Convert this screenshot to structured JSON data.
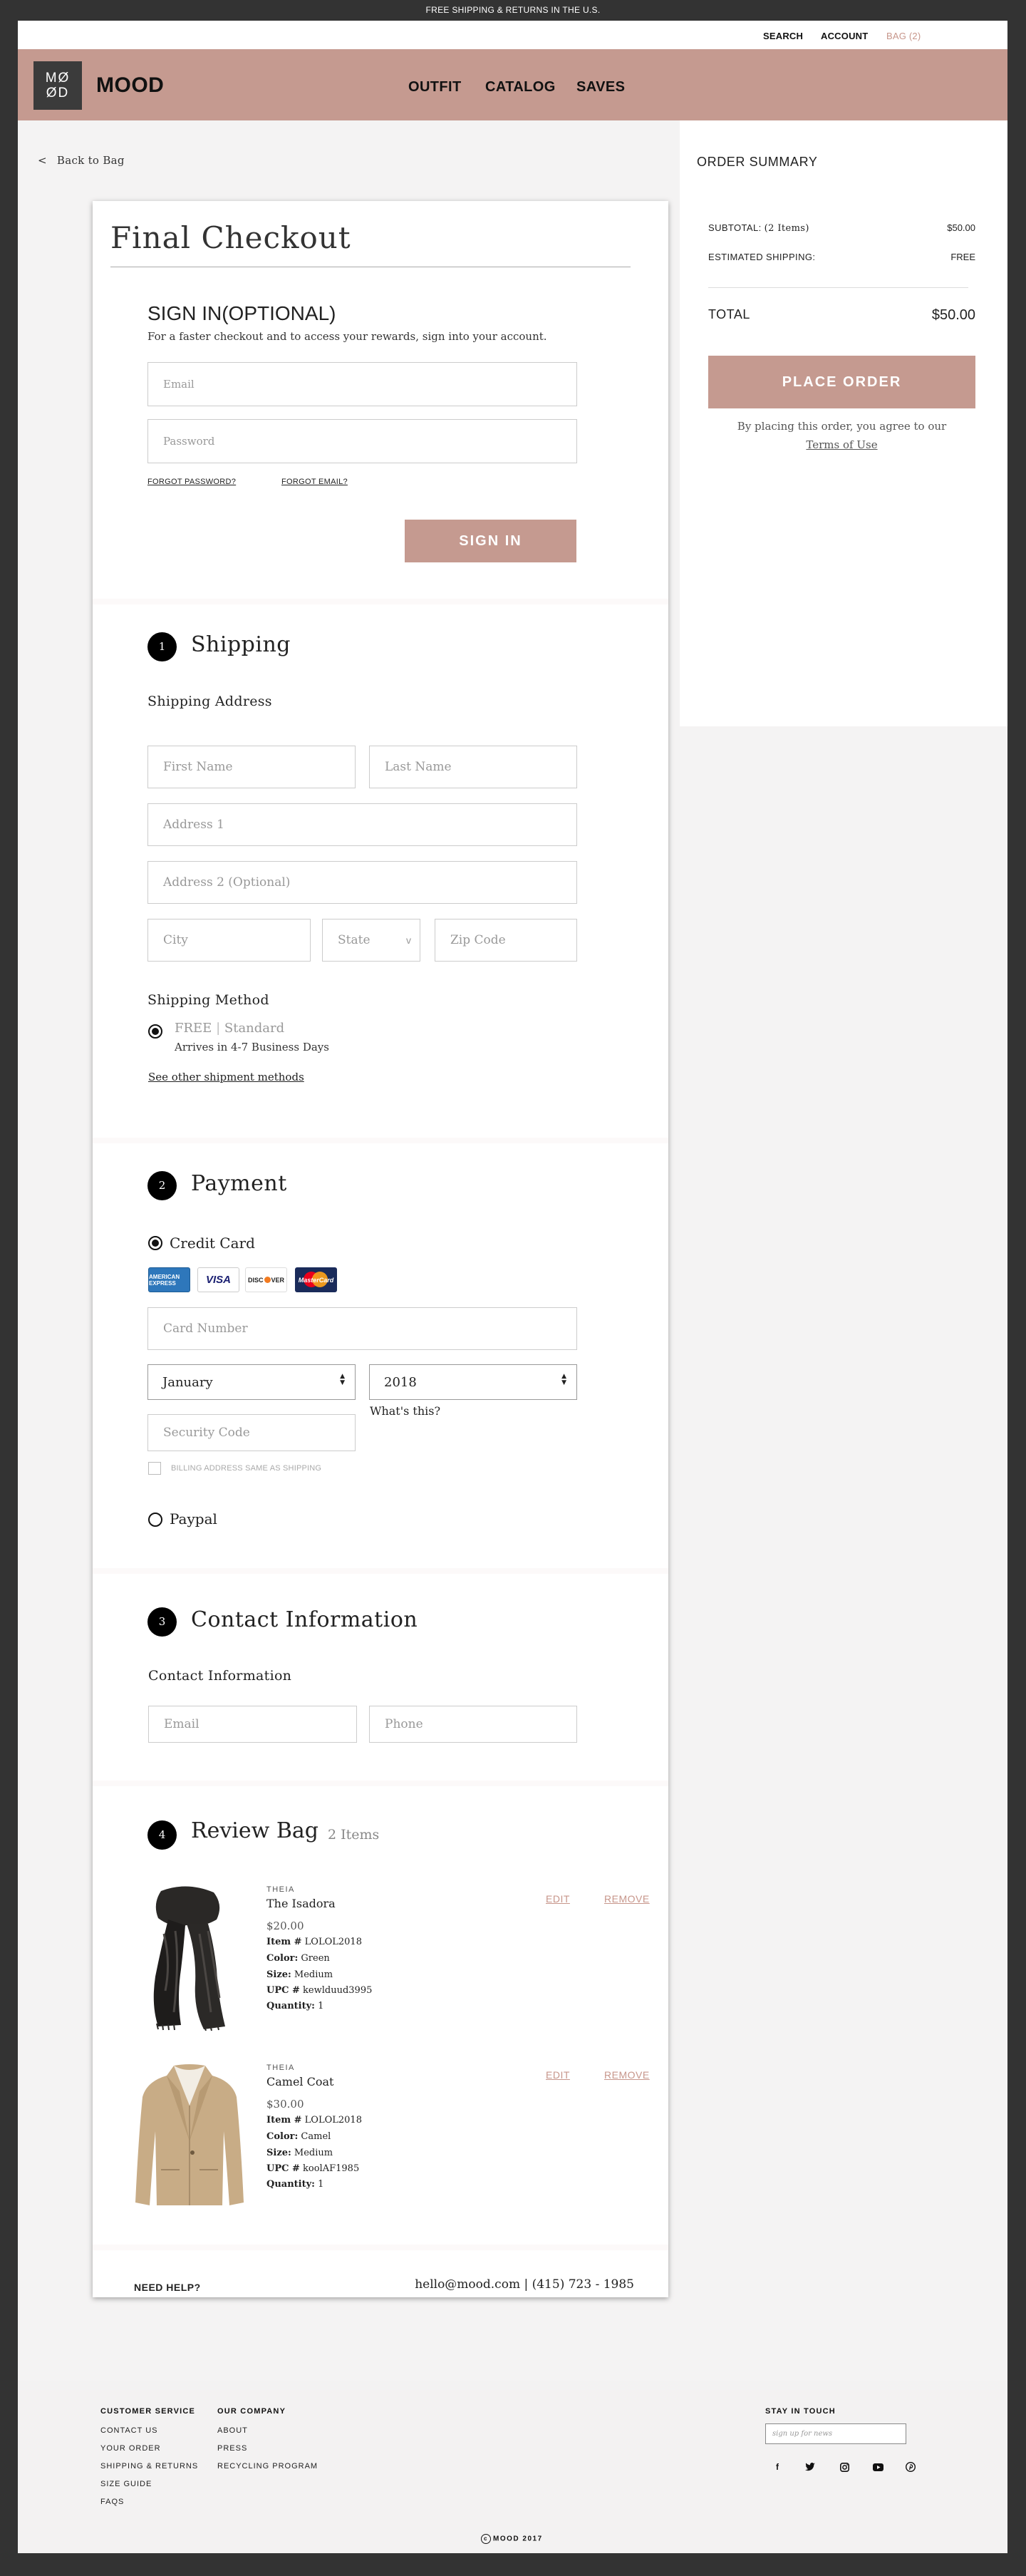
{
  "promo": "FREE SHIPPING & RETURNS IN THE U.S.",
  "utility": {
    "search": "SEARCH",
    "account": "ACCOUNT",
    "bag": "BAG (2)"
  },
  "logo": {
    "line1": "MØ",
    "line2": "ØD"
  },
  "brand": "MOOD",
  "nav": [
    "OUTFIT",
    "CATALOG",
    "SAVES"
  ],
  "back": {
    "chevron": "<",
    "label": "Back to Bag"
  },
  "summary": {
    "title": "ORDER SUMMARY",
    "subtotal_label": "SUBTOTAL:",
    "subtotal_items": "(2 Items)",
    "subtotal_value": "$50.00",
    "shipping_label": "ESTIMATED SHIPPING:",
    "shipping_value": "FREE",
    "total_label": "TOTAL",
    "total_value": "$50.00",
    "place_order": "PLACE ORDER",
    "agree_text": "By placing this order, you agree to our",
    "terms": "Terms of Use"
  },
  "checkout": {
    "title": "Final Checkout",
    "signin": {
      "heading": "SIGN IN(OPTIONAL)",
      "subtitle": "For a faster checkout and to access your rewards, sign into your account.",
      "email_placeholder": "Email",
      "password_placeholder": "Password",
      "forgot_password": "FORGOT PASSWORD?",
      "forgot_email": "FORGOT EMAIL?",
      "button": "SIGN IN"
    },
    "shipping": {
      "step": "1",
      "title": "Shipping",
      "address_heading": "Shipping Address",
      "first_name": "First Name",
      "last_name": "Last Name",
      "address1": "Address 1",
      "address2": "Address 2 (Optional)",
      "city": "City",
      "state": "State",
      "state_arrow": "v",
      "zip": "Zip Code",
      "method_heading": "Shipping Method",
      "method_free": "FREE",
      "method_sep": "|",
      "method_name": "Standard",
      "method_note": "Arrives in 4-7 Business Days",
      "other_methods": "See other shipment methods"
    },
    "payment": {
      "step": "2",
      "title": "Payment",
      "credit_card": "Credit Card",
      "cards": {
        "amex": "AMERICAN EXPRESS",
        "visa": "VISA",
        "discover_a": "DISC",
        "discover_b": "VER",
        "mastercard": "MasterCard"
      },
      "card_number": "Card Number",
      "month": "January",
      "year": "2018",
      "security_code": "Security Code",
      "whats_this": "What's this?",
      "billing_same": "BILLING ADDRESS SAME AS SHIPPING",
      "paypal": "Paypal"
    },
    "contact": {
      "step": "3",
      "title": "Contact Information",
      "heading": "Contact Information",
      "email": "Email",
      "phone": "Phone"
    },
    "review": {
      "step": "4",
      "title": "Review Bag",
      "count": "2 Items",
      "edit": "EDIT",
      "remove": "REMOVE",
      "items": [
        {
          "brand": "THEIA",
          "name": "The Isadora",
          "price": "$20.00",
          "item_label": "Item #",
          "item": "LOLOL2018",
          "color_label": "Color:",
          "color": "Green",
          "size_label": "Size:",
          "size": "Medium",
          "upc_label": "UPC #",
          "upc": "kewlduud3995",
          "qty_label": "Quantity:",
          "qty": "1"
        },
        {
          "brand": "THEIA",
          "name": "Camel Coat",
          "price": "$30.00",
          "item_label": "Item #",
          "item": "LOLOL2018",
          "color_label": "Color:",
          "color": "Camel",
          "size_label": "Size:",
          "size": "Medium",
          "upc_label": "UPC #",
          "upc": "koolAF1985",
          "qty_label": "Quantity:",
          "qty": "1"
        }
      ]
    },
    "help": {
      "label": "NEED HELP?",
      "email": "hello@mood.com",
      "sep": "|",
      "phone": "(415) 723 - 1985"
    }
  },
  "footer": {
    "customer_service": {
      "title": "CUSTOMER SERVICE",
      "links": [
        "CONTACT US",
        "YOUR ORDER",
        "SHIPPING & RETURNS",
        "SIZE GUIDE",
        "FAQS"
      ]
    },
    "company": {
      "title": "OUR COMPANY",
      "links": [
        "ABOUT",
        "PRESS",
        "RECYCLING PROGRAM"
      ]
    },
    "stay": {
      "title": "STAY IN TOUCH",
      "placeholder": "sign up for news"
    },
    "social": [
      "facebook-icon",
      "twitter-icon",
      "instagram-icon",
      "youtube-icon",
      "pinterest-icon"
    ],
    "copyright_symbol": "c",
    "copyright": "MOOD 2017"
  },
  "colors": {
    "accent": "#c59a90",
    "link_accent": "#c7968b",
    "dark": "#333333"
  }
}
